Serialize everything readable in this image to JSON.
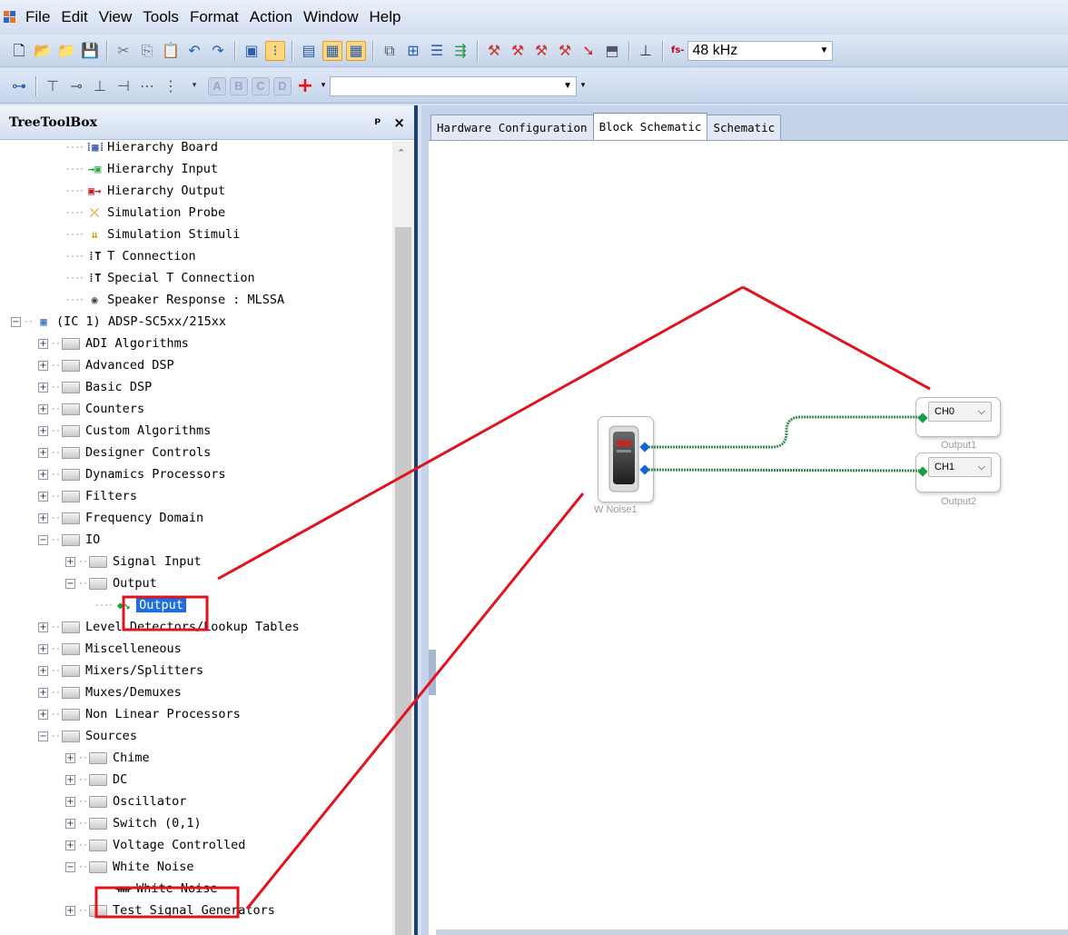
{
  "menu": [
    "File",
    "Edit",
    "View",
    "Tools",
    "Format",
    "Action",
    "Window",
    "Help"
  ],
  "toolbar": {
    "fs_label": "fs-",
    "sample_rate": "48 kHz",
    "abcd": [
      "A",
      "B",
      "C",
      "D"
    ],
    "add": "+",
    "search_value": ""
  },
  "toolbox": {
    "title": "TreeToolBox",
    "pin": "⇞",
    "close": "×",
    "items": [
      {
        "label": "Hierarchy Board",
        "indent": 2,
        "kind": "leaf",
        "icon": "hierarchy-board-icon"
      },
      {
        "label": "Hierarchy Input",
        "indent": 2,
        "kind": "leaf",
        "icon": "hierarchy-input-icon"
      },
      {
        "label": "Hierarchy Output",
        "indent": 2,
        "kind": "leaf",
        "icon": "hierarchy-output-icon"
      },
      {
        "label": "Simulation Probe",
        "indent": 2,
        "kind": "leaf",
        "icon": "simulation-probe-icon"
      },
      {
        "label": "Simulation Stimuli",
        "indent": 2,
        "kind": "leaf",
        "icon": "simulation-stimuli-icon"
      },
      {
        "label": "T Connection",
        "indent": 2,
        "kind": "leaf",
        "icon": "t-connection-icon"
      },
      {
        "label": "Special T Connection",
        "indent": 2,
        "kind": "leaf",
        "icon": "special-t-connection-icon"
      },
      {
        "label": "Speaker Response : MLSSA",
        "indent": 2,
        "kind": "leaf",
        "icon": "speaker-icon"
      },
      {
        "label": "(IC 1) ADSP-SC5xx/215xx",
        "indent": 0,
        "kind": "chip",
        "expanded": true
      },
      {
        "label": "ADI Algorithms",
        "indent": 1,
        "kind": "folder",
        "expanded": false
      },
      {
        "label": "Advanced DSP",
        "indent": 1,
        "kind": "folder",
        "expanded": false
      },
      {
        "label": "Basic DSP",
        "indent": 1,
        "kind": "folder",
        "expanded": false
      },
      {
        "label": "Counters",
        "indent": 1,
        "kind": "folder",
        "expanded": false
      },
      {
        "label": "Custom Algorithms",
        "indent": 1,
        "kind": "folder",
        "expanded": false
      },
      {
        "label": "Designer Controls",
        "indent": 1,
        "kind": "folder",
        "expanded": false
      },
      {
        "label": "Dynamics Processors",
        "indent": 1,
        "kind": "folder",
        "expanded": false
      },
      {
        "label": "Filters",
        "indent": 1,
        "kind": "folder",
        "expanded": false
      },
      {
        "label": "Frequency Domain",
        "indent": 1,
        "kind": "folder",
        "expanded": false
      },
      {
        "label": "IO",
        "indent": 1,
        "kind": "folder",
        "expanded": true
      },
      {
        "label": "Signal Input",
        "indent": 2,
        "kind": "folder",
        "expanded": false
      },
      {
        "label": "Output",
        "indent": 2,
        "kind": "folder",
        "expanded": true
      },
      {
        "label": "Output",
        "indent": 3,
        "kind": "leaf",
        "icon": "output-icon",
        "selected": true
      },
      {
        "label": "Level Detectors/Lookup Tables",
        "indent": 1,
        "kind": "folder",
        "expanded": false
      },
      {
        "label": "Miscelleneous",
        "indent": 1,
        "kind": "folder",
        "expanded": false
      },
      {
        "label": "Mixers/Splitters",
        "indent": 1,
        "kind": "folder",
        "expanded": false
      },
      {
        "label": "Muxes/Demuxes",
        "indent": 1,
        "kind": "folder",
        "expanded": false
      },
      {
        "label": "Non Linear Processors",
        "indent": 1,
        "kind": "folder",
        "expanded": false
      },
      {
        "label": "Sources",
        "indent": 1,
        "kind": "folder",
        "expanded": true
      },
      {
        "label": "Chime",
        "indent": 2,
        "kind": "folder",
        "expanded": false
      },
      {
        "label": "DC",
        "indent": 2,
        "kind": "folder",
        "expanded": false
      },
      {
        "label": "Oscillator",
        "indent": 2,
        "kind": "folder",
        "expanded": false
      },
      {
        "label": "Switch (0,1)",
        "indent": 2,
        "kind": "folder",
        "expanded": false
      },
      {
        "label": "Voltage Controlled",
        "indent": 2,
        "kind": "folder",
        "expanded": false
      },
      {
        "label": "White Noise",
        "indent": 2,
        "kind": "folder",
        "expanded": true
      },
      {
        "label": "White Noise",
        "indent": 3,
        "kind": "leaf",
        "icon": "white-noise-icon"
      },
      {
        "label": "Test Signal Generators",
        "indent": 2,
        "kind": "folder",
        "expanded": false
      }
    ]
  },
  "tabs": [
    {
      "label": "Hardware Configuration",
      "active": false
    },
    {
      "label": "Block Schematic",
      "active": true
    },
    {
      "label": "Schematic",
      "active": false
    }
  ],
  "schematic": {
    "source_block": "W Noise1",
    "outputs": [
      {
        "label": "Output1",
        "channel": "CH0"
      },
      {
        "label": "Output2",
        "channel": "CH1"
      }
    ]
  },
  "colors": {
    "annotation": "#e0141e",
    "wire": "#3e8a52",
    "pin_out": "#1565d8",
    "pin_in": "#16a046",
    "selection": "#1e6fd9"
  }
}
